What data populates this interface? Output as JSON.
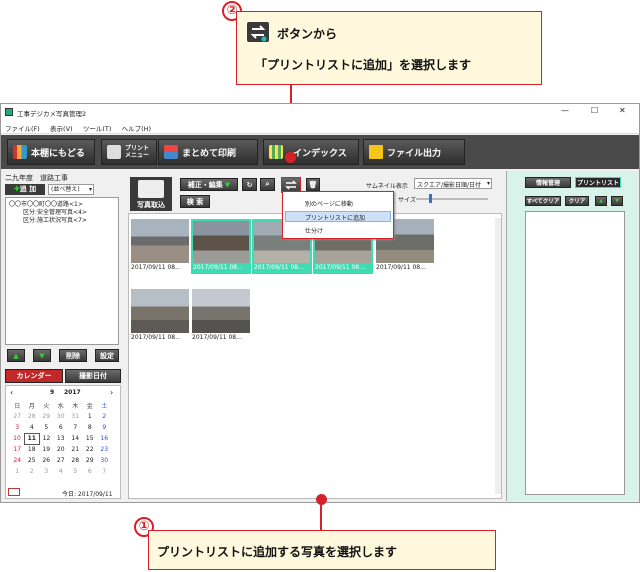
{
  "callout1": {
    "number": "①",
    "text": "プリントリストに追加する写真を選択します"
  },
  "callout2": {
    "number": "②",
    "line1": "ボタンから",
    "line2": "「プリントリストに追加」を選択します"
  },
  "window": {
    "title": "工事デジカメ写真管理2",
    "controls": {
      "minimize": "—",
      "maximize": "☐",
      "close": "✕"
    },
    "menu": [
      "ファイル(F)",
      "表示(V)",
      "ツール(T)",
      "ヘルプ(H)"
    ]
  },
  "toolbar": {
    "bookshelf": "本棚にもどる",
    "print_menu_1": "プリント",
    "print_menu_2": "メニュー",
    "batch_print": "まとめて印刷",
    "index": "インデックス",
    "file_output": "ファイル出力"
  },
  "left": {
    "project": "二九年度　道路工事",
    "add": "追 加",
    "sort": "(並べ替え)",
    "tree": [
      "〇〇市〇〇町〇〇道路<1>",
      "区分:安全管理写真<4>",
      "区分:施工状況写真<7>"
    ],
    "delete": "削除",
    "settings": "設定",
    "calendar_tab": "カレンダー",
    "date_tab": "撮影日付"
  },
  "calendar": {
    "month": "9",
    "year": "2017",
    "weekdays": [
      "日",
      "月",
      "火",
      "水",
      "木",
      "金",
      "土"
    ],
    "weeks": [
      [
        "27",
        "28",
        "29",
        "30",
        "31",
        "1",
        "2"
      ],
      [
        "3",
        "4",
        "5",
        "6",
        "7",
        "8",
        "9"
      ],
      [
        "10",
        "11",
        "12",
        "13",
        "14",
        "15",
        "16"
      ],
      [
        "17",
        "18",
        "19",
        "20",
        "21",
        "22",
        "23"
      ],
      [
        "24",
        "25",
        "26",
        "27",
        "28",
        "29",
        "30"
      ],
      [
        "1",
        "2",
        "3",
        "4",
        "5",
        "6",
        "7"
      ]
    ],
    "today": "今日: 2017/09/11"
  },
  "center": {
    "import": "写真取込",
    "edit": "補正・編集",
    "search": "検 索",
    "thumb_label": "サムネイル表示",
    "thumb_value": "スクエア/撮影日順/日付",
    "size_label": "サイズ"
  },
  "dropdown": [
    "別のページに移動",
    "プリントリストに追加",
    "仕分け"
  ],
  "photos": [
    {
      "caption": "2017/09/11 08..."
    },
    {
      "caption": "2017/09/11 08..."
    },
    {
      "caption": "2017/09/11 08..."
    },
    {
      "caption": "2017/09/11 08..."
    },
    {
      "caption": "2017/09/11 08..."
    },
    {
      "caption": "2017/09/11 08..."
    },
    {
      "caption": "2017/09/11 08..."
    }
  ],
  "right": {
    "info": "情報管理",
    "printlist": "プリントリスト",
    "clear_all": "すべてクリア",
    "clear": "クリア"
  },
  "colors": {
    "accent": "#d8202a",
    "selected": "#3fdcb4",
    "panel": "#d8f3ea"
  }
}
